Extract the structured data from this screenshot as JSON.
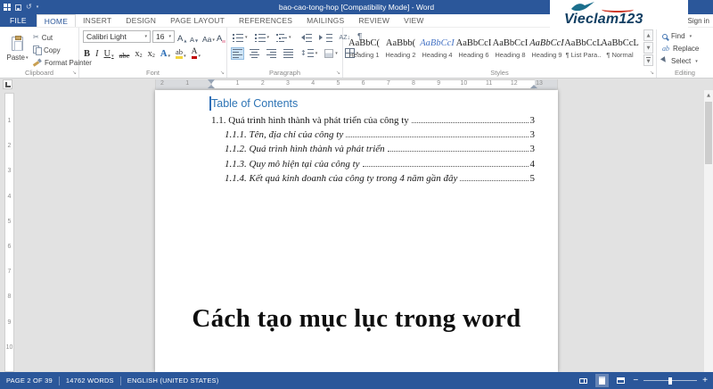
{
  "titlebar": {
    "title": "bao-cao-tong-hop [Compatibility Mode] - Word",
    "sign_in": "Sign in"
  },
  "brand": {
    "name": "Vieclam123"
  },
  "ribbon": {
    "tabs": [
      {
        "label": "FILE",
        "file_tab": true,
        "active": false
      },
      {
        "label": "HOME",
        "file_tab": false,
        "active": true
      },
      {
        "label": "INSERT",
        "file_tab": false,
        "active": false
      },
      {
        "label": "DESIGN",
        "file_tab": false,
        "active": false
      },
      {
        "label": "PAGE LAYOUT",
        "file_tab": false,
        "active": false
      },
      {
        "label": "REFERENCES",
        "file_tab": false,
        "active": false
      },
      {
        "label": "MAILINGS",
        "file_tab": false,
        "active": false
      },
      {
        "label": "REVIEW",
        "file_tab": false,
        "active": false
      },
      {
        "label": "VIEW",
        "file_tab": false,
        "active": false
      }
    ],
    "groups": {
      "clipboard": {
        "label": "Clipboard",
        "paste": "Paste",
        "cut": "Cut",
        "copy": "Copy",
        "format_painter": "Format Painter"
      },
      "font": {
        "label": "Font",
        "font_name": "Calibri Light",
        "font_size": "16"
      },
      "paragraph": {
        "label": "Paragraph"
      },
      "styles": {
        "label": "Styles",
        "items": [
          {
            "preview": "AaBbC(",
            "name": "Heading 1",
            "blue": false,
            "italic": false
          },
          {
            "preview": "AaBbb(",
            "name": "Heading 2",
            "blue": false,
            "italic": false
          },
          {
            "preview": "AaBbCcI",
            "name": "Heading 4",
            "blue": true,
            "italic": true
          },
          {
            "preview": "AaBbCcI",
            "name": "Heading 6",
            "blue": false,
            "italic": false
          },
          {
            "preview": "AaBbCcI",
            "name": "Heading 8",
            "blue": false,
            "italic": false
          },
          {
            "preview": "AaBbCcI",
            "name": "Heading 9",
            "blue": false,
            "italic": true
          },
          {
            "preview": "AaBbCcL",
            "name": "¶ List Para...",
            "blue": false,
            "italic": false
          },
          {
            "preview": "AaBbCcL",
            "name": "¶ Normal",
            "blue": false,
            "italic": false
          }
        ]
      },
      "editing": {
        "label": "Editing",
        "find": "Find",
        "replace": "Replace",
        "select": "Select"
      }
    }
  },
  "rulers": {
    "horizontal": [
      "2",
      "1",
      "",
      "1",
      "2",
      "3",
      "4",
      "5",
      "6",
      "7",
      "8",
      "9",
      "10",
      "11",
      "12",
      "13"
    ],
    "vertical": [
      "1",
      "2",
      "3",
      "4",
      "5",
      "6",
      "7",
      "8",
      "9",
      "10"
    ]
  },
  "document": {
    "toc_title": "Table of Contents",
    "toc_entries": [
      {
        "text": "1.1. Quá trình hình thành và phát triển của công ty",
        "page": "3",
        "level": 1
      },
      {
        "text": "1.1.1. Tên, địa chỉ của công ty",
        "page": "3",
        "level": 2
      },
      {
        "text": "1.1.2. Quá trình hình thành và phát triển",
        "page": "3",
        "level": 2
      },
      {
        "text": "1.1.3. Quy mô hiện tại của công ty",
        "page": "4",
        "level": 2
      },
      {
        "text": "1.1.4. Kết quả kinh doanh của công ty trong 4 năm gần đây",
        "page": "5",
        "level": 2
      }
    ],
    "caption": "Cách tạo mục lục trong word"
  },
  "statusbar": {
    "page": "PAGE 2 OF 39",
    "words": "14762 WORDS",
    "language": "ENGLISH (UNITED STATES)"
  }
}
